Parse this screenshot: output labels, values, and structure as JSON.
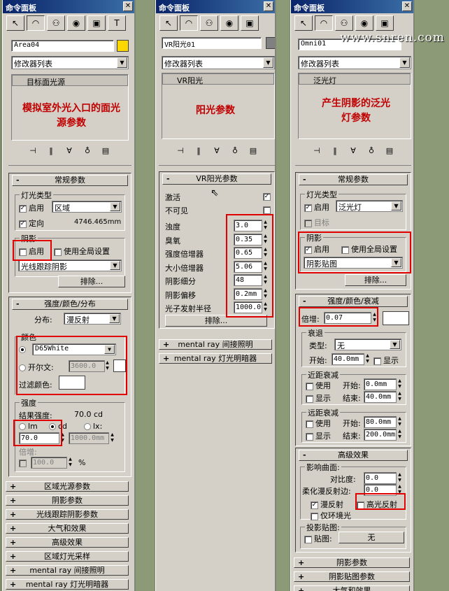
{
  "watermark": "www.snren.com",
  "panel1": {
    "title": "命令面板",
    "object_name": "Area04",
    "color": "#ffd700",
    "modifier_list": "修改器列表",
    "stack_item": "目标面光源",
    "note": "模拟室外光入口的面光源参数",
    "general": {
      "header": "常规参数",
      "light_type_group": "灯光类型",
      "enable_label": "启用",
      "type_value": "区域",
      "targeted_label": "定向",
      "distance": "4746.465mm",
      "shadow_group": "阴影",
      "shadow_enable": "启用",
      "use_global": "使用全局设置",
      "shadow_type": "光线跟踪阴影",
      "exclude": "排除..."
    },
    "intensity": {
      "header": "强度/颜色/分布",
      "distribution_label": "分布:",
      "distribution_value": "漫反射",
      "color_group": "颜色",
      "preset": "D65White",
      "kelvin_label": "开尔文:",
      "kelvin_value": "3600.0",
      "filter_label": "过滤颜色:",
      "intensity_group": "强度",
      "result_label": "结果强度:",
      "result_value": "70.0 cd",
      "unit_lm": "lm",
      "unit_cd": "cd",
      "unit_lx": "lx:",
      "value": "70.0",
      "lx_value": "1000.0mm",
      "multiplier_label": "倍增:",
      "multiplier_value": "100.0",
      "percent": "%"
    },
    "rollouts": [
      "区域光源参数",
      "阴影参数",
      "光线跟踪阴影参数",
      "大气和效果",
      "高级效果",
      "区域灯光采样",
      "mental ray 间接照明",
      "mental ray 灯光明暗器"
    ]
  },
  "panel2": {
    "title": "命令面板",
    "object_name": "VR阳光01",
    "color": "#808080",
    "modifier_list": "修改器列表",
    "stack_item": "VR阳光",
    "note": "阳光参数",
    "params_header": "VR阳光参数",
    "enabled_label": "激活",
    "invisible_label": "不可见",
    "params": [
      {
        "label": "浊度",
        "value": "3.0"
      },
      {
        "label": "臭氧",
        "value": "0.35"
      },
      {
        "label": "强度倍增器",
        "value": "0.65"
      },
      {
        "label": "大小倍增器",
        "value": "5.06"
      },
      {
        "label": "阴影细分",
        "value": "48"
      },
      {
        "label": "阴影偏移",
        "value": "0.2mm"
      },
      {
        "label": "光子发射半径",
        "value": "1000.0"
      }
    ],
    "exclude": "排除...",
    "rollouts": [
      "mental ray 间接照明",
      "mental ray 灯光明暗器"
    ]
  },
  "panel3": {
    "title": "命令面板",
    "object_name": "Omni01",
    "modifier_list": "修改器列表",
    "stack_item": "泛光灯",
    "note": "产生阴影的泛光灯参数",
    "general": {
      "header": "常规参数",
      "light_type_group": "灯光类型",
      "enable_label": "启用",
      "type_value": "泛光灯",
      "target_label": "目标",
      "shadow_group": "阴影",
      "shadow_enable": "启用",
      "use_global": "使用全局设置",
      "shadow_type": "阴影贴图",
      "exclude": "排除..."
    },
    "intensity": {
      "header": "强度/颜色/衰减",
      "multiplier_label": "倍增:",
      "multiplier_value": "0.07",
      "decay_group": "衰退",
      "type_label": "类型:",
      "type_value": "无",
      "start_label": "开始:",
      "start_value": "40.0mm",
      "show_label": "显示",
      "near_group": "近距衰减",
      "use_label": "使用",
      "near_start_label": "开始:",
      "near_start": "0.0mm",
      "display_label": "显示",
      "end_label": "结束:",
      "near_end": "40.0mm",
      "far_group": "远距衰减",
      "far_start": "80.0mm",
      "far_end": "200.0mm"
    },
    "advanced": {
      "header": "高级效果",
      "affect_group": "影响曲面:",
      "contrast_label": "对比度:",
      "contrast_value": "0.0",
      "soften_label": "柔化漫反射边:",
      "soften_value": "0.0",
      "diffuse_label": "漫反射",
      "specular_label": "高光反射",
      "ambient_label": "仅环境光",
      "proj_group": "投影贴图:",
      "map_label": "贴图:",
      "map_button": "无"
    },
    "rollouts": [
      "阴影参数",
      "阴影贴图参数",
      "大气和效果"
    ]
  }
}
